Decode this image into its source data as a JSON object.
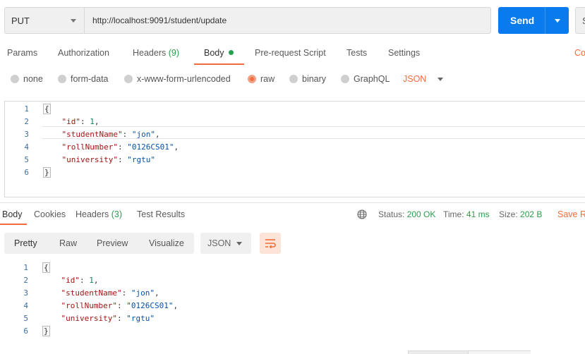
{
  "request": {
    "method": "PUT",
    "url": "http://localhost:9091/student/update",
    "send_label": "Send",
    "save_stub": "S"
  },
  "request_tabs": [
    {
      "label": "Params"
    },
    {
      "label": "Authorization"
    },
    {
      "label": "Headers",
      "count": "(9)"
    },
    {
      "label": "Body",
      "active": true
    },
    {
      "label": "Pre-request Script"
    },
    {
      "label": "Tests"
    },
    {
      "label": "Settings"
    }
  ],
  "cookies_link": "Co",
  "body_types": [
    {
      "label": "none",
      "selected": false
    },
    {
      "label": "form-data",
      "selected": false
    },
    {
      "label": "x-www-form-urlencoded",
      "selected": false
    },
    {
      "label": "raw",
      "selected": true
    },
    {
      "label": "binary",
      "selected": false
    },
    {
      "label": "GraphQL",
      "selected": false
    }
  ],
  "body_language": "JSON",
  "request_body": {
    "line_numbers": [
      "1",
      "2",
      "3",
      "4",
      "5",
      "6"
    ],
    "open_brace": "{",
    "close_brace": "}",
    "fields": [
      {
        "key": "\"id\"",
        "sep": ": ",
        "value": "1",
        "type": "num",
        "trail": ","
      },
      {
        "key": "\"studentName\"",
        "sep": ": ",
        "value": "\"jon\"",
        "type": "str",
        "trail": ","
      },
      {
        "key": "\"rollNumber\"",
        "sep": ": ",
        "value": "\"0126CS01\"",
        "type": "str",
        "trail": ","
      },
      {
        "key": "\"university\"",
        "sep": ": ",
        "value": "\"rgtu\"",
        "type": "str",
        "trail": ""
      }
    ]
  },
  "response_tabs": [
    {
      "label": "Body",
      "active": true
    },
    {
      "label": "Cookies"
    },
    {
      "label": "Headers",
      "count": "(3)"
    },
    {
      "label": "Test Results"
    }
  ],
  "response_meta": {
    "status_label": "Status:",
    "status_value": "200 OK",
    "time_label": "Time:",
    "time_value": "41 ms",
    "size_label": "Size:",
    "size_value": "202 B",
    "save_response": "Save R"
  },
  "format_buttons": [
    {
      "label": "Pretty",
      "active": true
    },
    {
      "label": "Raw"
    },
    {
      "label": "Preview"
    },
    {
      "label": "Visualize"
    }
  ],
  "response_language": "JSON",
  "response_body": {
    "line_numbers": [
      "1",
      "2",
      "3",
      "4",
      "5",
      "6"
    ],
    "open_brace": "{",
    "close_brace": "}",
    "fields": [
      {
        "key": "\"id\"",
        "sep": ": ",
        "value": "1",
        "type": "num",
        "trail": ","
      },
      {
        "key": "\"studentName\"",
        "sep": ": ",
        "value": "\"jon\"",
        "type": "str",
        "trail": ","
      },
      {
        "key": "\"rollNumber\"",
        "sep": ": ",
        "value": "\"0126CS01\"",
        "type": "str",
        "trail": ","
      },
      {
        "key": "\"university\"",
        "sep": ": ",
        "value": "\"rgtu\"",
        "type": "str",
        "trail": ""
      }
    ]
  },
  "colors": {
    "accent": "#f26b3a",
    "send": "#097bed",
    "success": "#2d9c4b"
  },
  "icons": [
    "globe-icon",
    "wrap-lines-icon",
    "chevron-down-icon"
  ]
}
